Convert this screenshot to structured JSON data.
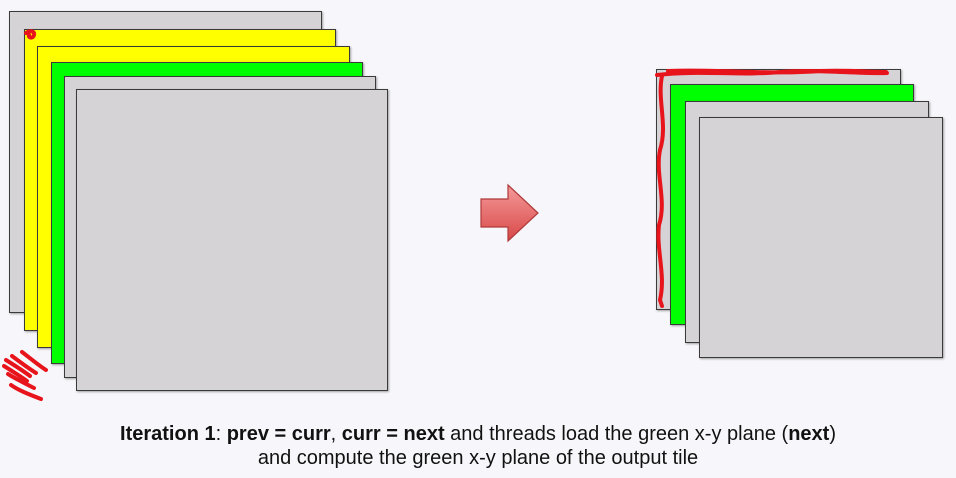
{
  "colors": {
    "background": "#f7f7fb",
    "gray_plane": "#d6d3d6",
    "yellow_plane": "#ffff00",
    "green_plane": "#00ff00",
    "arrow_fill": "#e96060",
    "annotation_ink": "#e8141c"
  },
  "left_stack": {
    "planes": [
      {
        "name": "gray",
        "color": "#d6d3d6"
      },
      {
        "name": "yellow",
        "color": "#ffff00"
      },
      {
        "name": "yellow",
        "color": "#ffff00"
      },
      {
        "name": "green",
        "color": "#00ff00"
      },
      {
        "name": "gray",
        "color": "#d6d3d6"
      },
      {
        "name": "gray",
        "color": "#d6d3d6"
      }
    ]
  },
  "right_stack": {
    "planes": [
      {
        "name": "gray",
        "color": "#d6d3d6"
      },
      {
        "name": "green",
        "color": "#00ff00"
      },
      {
        "name": "gray",
        "color": "#d6d3d6"
      },
      {
        "name": "gray",
        "color": "#d6d3d6"
      }
    ]
  },
  "caption": {
    "line1": {
      "iteration": "Iteration 1",
      "sep": ": ",
      "assign1": "prev = curr",
      "comma": ", ",
      "assign2": "curr = next",
      "middle": " and threads load the green x-y plane (",
      "next": "next",
      "close": ")"
    },
    "line2": "and compute the green x-y plane of the output tile"
  }
}
